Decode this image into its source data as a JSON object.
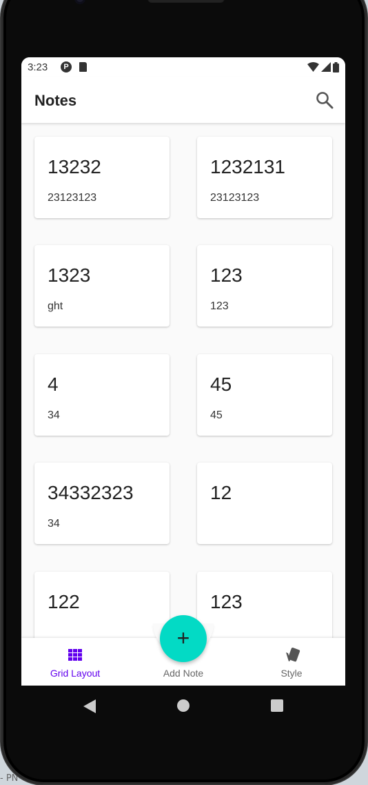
{
  "status_bar": {
    "time": "3:23"
  },
  "app_bar": {
    "title": "Notes"
  },
  "notes": [
    {
      "title": "13232",
      "body": "23123123"
    },
    {
      "title": "1232131",
      "body": "23123123"
    },
    {
      "title": "1323",
      "body": "ght"
    },
    {
      "title": "123",
      "body": "123"
    },
    {
      "title": "4",
      "body": "34"
    },
    {
      "title": "45",
      "body": "45"
    },
    {
      "title": "34332323",
      "body": "34"
    },
    {
      "title": "12",
      "body": ""
    },
    {
      "title": "122",
      "body": ""
    },
    {
      "title": "123",
      "body": ""
    }
  ],
  "bottom_nav": {
    "grid_label": "Grid Layout",
    "add_label": "Add Note",
    "style_label": "Style",
    "fab_symbol": "+"
  },
  "colors": {
    "accent": "#6200ee",
    "fab": "#03dac5"
  },
  "background_fragment": "- PN"
}
